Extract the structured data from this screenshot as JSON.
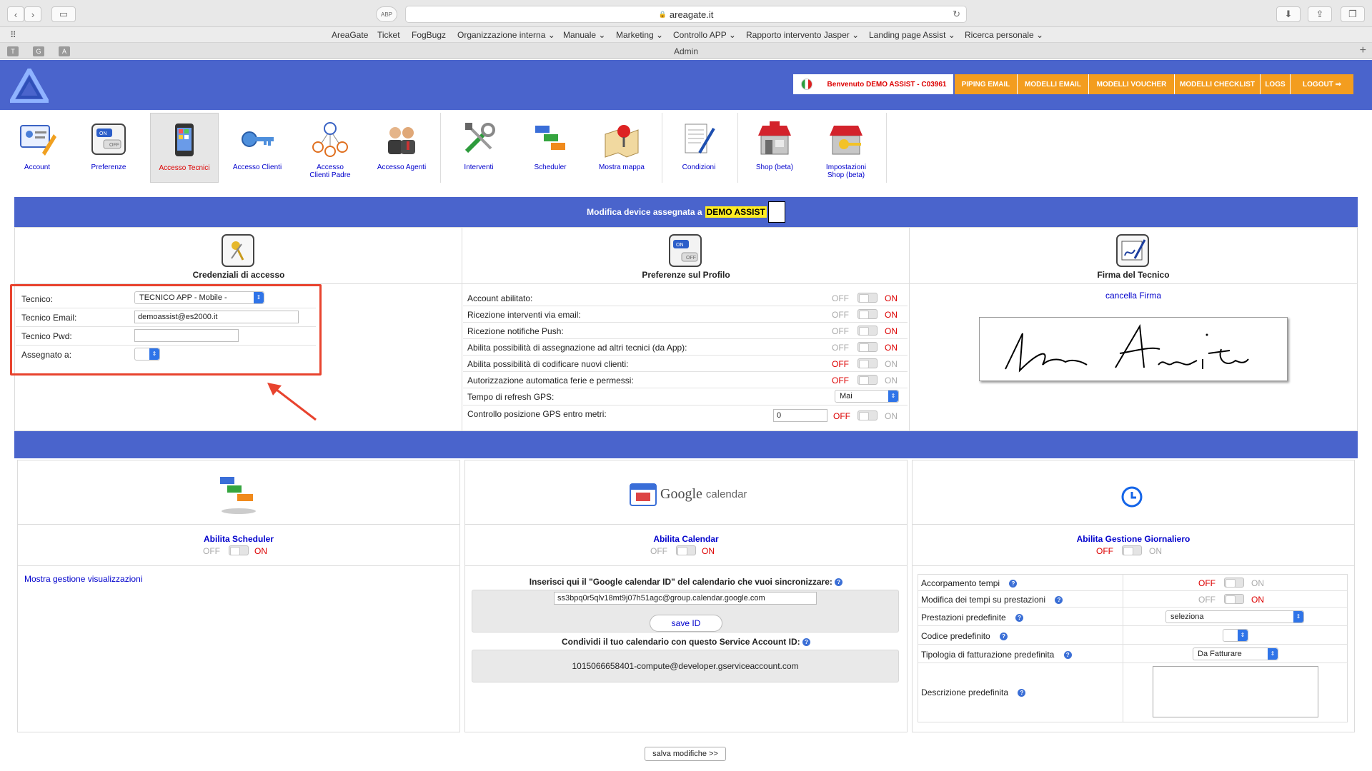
{
  "browser": {
    "url": "areagate.it",
    "bookmarks": [
      "AreaGate",
      "Ticket",
      "FogBugz",
      "Organizzazione interna",
      "Manuale",
      "Marketing",
      "Controllo APP",
      "Rapporto intervento Jasper",
      "Landing page Assist",
      "Ricerca personale"
    ],
    "tab_letters": [
      "T",
      "G",
      "A"
    ],
    "tab_title": "Admin"
  },
  "header": {
    "welcome": "Benvenuto DEMO ASSIST - C03961",
    "buttons": [
      "PIPING EMAIL",
      "MODELLI EMAIL",
      "MODELLI VOUCHER",
      "MODELLI CHECKLIST",
      "LOGS",
      "LOGOUT ⇒"
    ]
  },
  "nav": [
    {
      "label": "Account"
    },
    {
      "label": "Preferenze"
    },
    {
      "label": "Accesso Tecnici"
    },
    {
      "label": "Accesso Clienti"
    },
    {
      "label": "Accesso Clienti Padre"
    },
    {
      "label": "Accesso Agenti"
    },
    {
      "label": "Interventi"
    },
    {
      "label": "Scheduler"
    },
    {
      "label": "Mostra mappa"
    },
    {
      "label": "Condizioni"
    },
    {
      "label": "Shop (beta)"
    },
    {
      "label": "Impostazioni Shop (beta)"
    }
  ],
  "device_panel": {
    "title": "Modifica device assegnata a",
    "highlight": "DEMO ASSIST",
    "credentials": {
      "heading": "Credenziali di accesso",
      "tecnico_label": "Tecnico:",
      "tecnico_value": "TECNICO APP - Mobile -",
      "email_label": "Tecnico Email:",
      "email_value": "demoassist@es2000.it",
      "pwd_label": "Tecnico Pwd:",
      "assegnato_label": "Assegnato a:"
    },
    "preferences": {
      "heading": "Preferenze sul Profilo",
      "off": "OFF",
      "on": "ON",
      "rows": [
        {
          "label": "Account abilitato:",
          "state": "on"
        },
        {
          "label": "Ricezione interventi via email:",
          "state": "on"
        },
        {
          "label": "Ricezione notifiche Push:",
          "state": "on"
        },
        {
          "label": "Abilita possibilità di assegnazione ad altri tecnici (da App):",
          "state": "on"
        },
        {
          "label": "Abilita possibilità di codificare nuovi clienti:",
          "state": "off"
        },
        {
          "label": "Autorizzazione automatica ferie e permessi:",
          "state": "off"
        }
      ],
      "gps_refresh_label": "Tempo di refresh GPS:",
      "gps_refresh_value": "Mai",
      "gps_meters_label": "Controllo posizione GPS entro metri:",
      "gps_meters_value": "0",
      "gps_meters_state": "off"
    },
    "signature": {
      "heading": "Firma del Tecnico",
      "clear_link": "cancella Firma"
    }
  },
  "modules": {
    "scheduler": {
      "title": "Abilita Scheduler",
      "off": "OFF",
      "on": "ON",
      "state": "on",
      "link": "Mostra gestione visualizzazioni"
    },
    "calendar": {
      "logo_google": "Google",
      "logo_calendar": "calendar",
      "title": "Abilita Calendar",
      "off": "OFF",
      "on": "ON",
      "state": "on",
      "id_prompt": "Inserisci qui il \"Google calendar ID\" del calendario che vuoi sincronizzare:",
      "id_value": "ss3bpq0r5qlv18mt9j07h51agc@group.calendar.google.com",
      "save_label": "save ID",
      "share_prompt": "Condividi il tuo calendario con questo Service Account ID:",
      "service_account": "1015066658401-compute@developer.gserviceaccount.com"
    },
    "daily": {
      "title": "Abilita Gestione Giornaliero",
      "off": "OFF",
      "on": "ON",
      "state": "off",
      "rows": {
        "accorpamento": "Accorpamento tempi",
        "modifica": "Modifica dei tempi su prestazioni",
        "prestazioni": "Prestazioni predefinite",
        "prestazioni_value": "seleziona",
        "codice": "Codice predefinito",
        "tipologia": "Tipologia di fatturazione predefinita",
        "tipologia_value": "Da Fatturare",
        "descrizione": "Descrizione predefinita"
      },
      "accorpamento_state": "off",
      "modifica_state": "on"
    }
  },
  "footer": {
    "save_label": "salva modifiche >>"
  },
  "colors": {
    "brand_blue": "#4a64cc",
    "orange": "#f39d1f",
    "annotation_red": "#e8432e"
  }
}
